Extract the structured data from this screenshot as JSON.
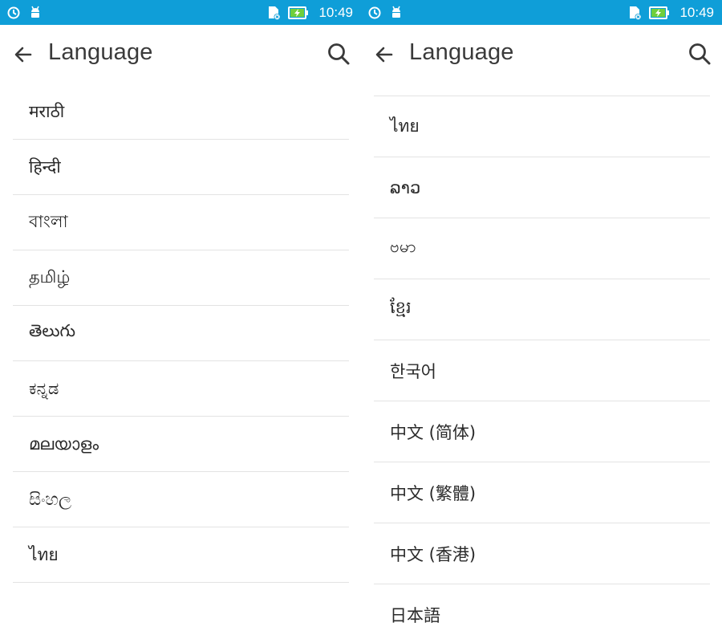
{
  "colors": {
    "statusbar": "#0f9ed8",
    "divider": "#e3e3e3",
    "title": "#3a3a3a",
    "text": "#2a2a2a"
  },
  "screens": [
    {
      "statusbar": {
        "time": "10:49"
      },
      "appbar": {
        "title": "Language"
      },
      "items": [
        "मराठी",
        "हिन्दी",
        "বাংলা",
        "தமிழ்",
        "తెలుగు",
        "ಕನ್ನಡ",
        "മലയാളം",
        "සිංහල",
        "ไทย"
      ]
    },
    {
      "statusbar": {
        "time": "10:49"
      },
      "appbar": {
        "title": "Language"
      },
      "items": [
        "ไทย",
        "ລາວ",
        "ဗမာ",
        "ខ្មែរ",
        "한국어",
        "中文 (简体)",
        "中文 (繁體)",
        "中文 (香港)",
        "日本語"
      ]
    }
  ]
}
